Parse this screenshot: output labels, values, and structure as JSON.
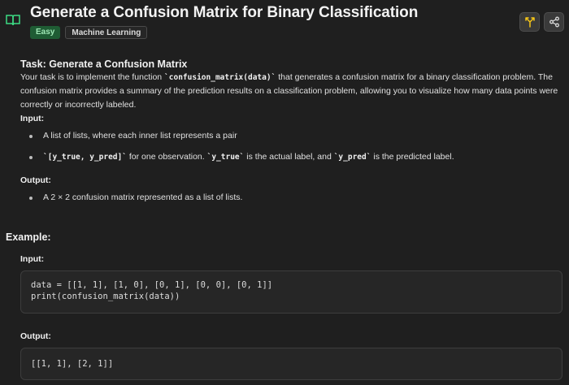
{
  "header": {
    "title": "Generate a Confusion Matrix for Binary Classification",
    "difficulty": "Easy",
    "category": "Machine Learning",
    "icons": [
      "book-icon",
      "split-icon",
      "share-icon"
    ],
    "accent_color": "#3ddc84"
  },
  "task": {
    "heading": "Task: Generate a Confusion Matrix",
    "p1_before": "Your task is to implement the function ",
    "p1_code": "`confusion_matrix(data)`",
    "p1_after": " that generates a confusion matrix for a binary classification problem. The confusion matrix provides a summary of the prediction results on a classification problem, allowing you to visualize how many data points were correctly or incorrectly labeled.",
    "input_heading": "Input:",
    "input_items": [
      {
        "text": "A list of lists, where each inner list represents a pair"
      },
      {
        "code1": "`[y_true, y_pred]`",
        "text1": " for one observation. ",
        "code2": "`y_true`",
        "text2": " is the actual label, and ",
        "code3": "`y_pred`",
        "text3": " is the predicted label."
      }
    ],
    "output_heading": "Output:",
    "output_item": "A 2 × 2 confusion matrix represented as a list of lists."
  },
  "example": {
    "heading": "Example:",
    "input_label": "Input:",
    "input_code": "data = [[1, 1], [1, 0], [0, 1], [0, 0], [0, 1]]\nprint(confusion_matrix(data))",
    "output_label": "Output:",
    "output_code": "[[1, 1], [2, 1]]"
  }
}
